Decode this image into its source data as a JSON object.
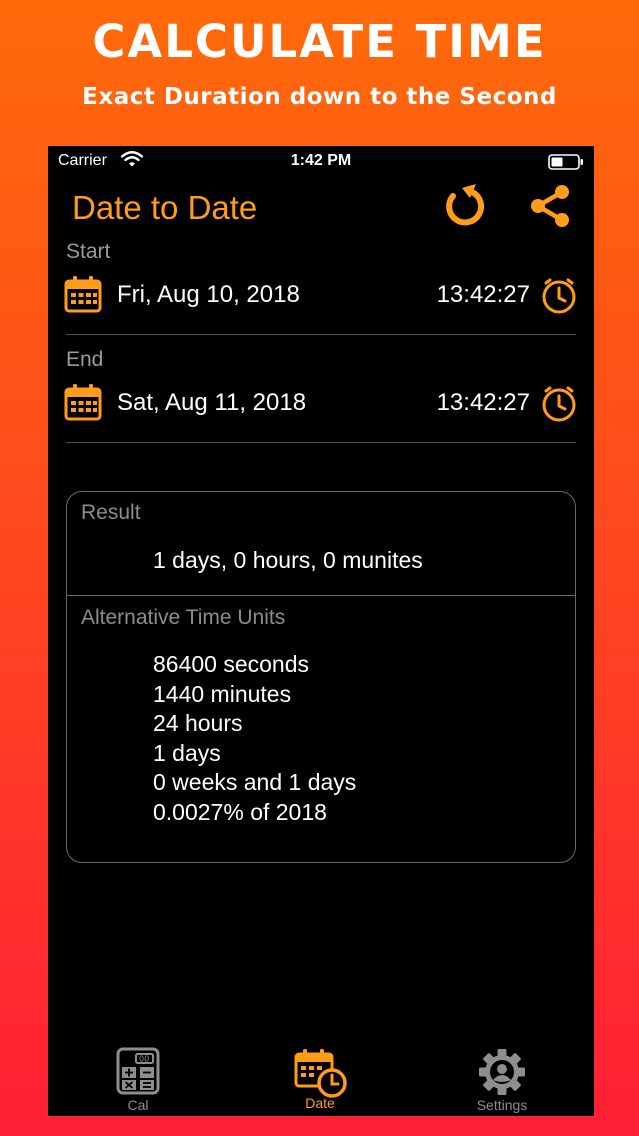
{
  "promo": {
    "title": "CALCULATE TIME",
    "subtitle": "Exact Duration down to the Second"
  },
  "status_bar": {
    "carrier": "Carrier",
    "time": "1:42 PM",
    "icons": [
      "wifi-icon",
      "battery-icon"
    ]
  },
  "nav": {
    "title": "Date to Date",
    "actions": [
      "refresh-icon",
      "share-icon"
    ]
  },
  "start": {
    "label": "Start",
    "date": "Fri, Aug 10, 2018",
    "time": "13:42:27"
  },
  "end": {
    "label": "End",
    "date": "Sat, Aug 11, 2018",
    "time": "13:42:27"
  },
  "result": {
    "label": "Result",
    "value": "1 days, 0 hours, 0 munites"
  },
  "alternative": {
    "label": "Alternative Time Units",
    "items": [
      "86400 seconds",
      "1440 minutes",
      "24 hours",
      "1 days",
      "0 weeks and 1 days",
      "0.0027% of 2018"
    ]
  },
  "tabs": [
    {
      "label": "Cal",
      "icon": "calculator-icon",
      "active": false
    },
    {
      "label": "Date",
      "icon": "calendar-clock-icon",
      "active": true
    },
    {
      "label": "Settings",
      "icon": "gear-icon",
      "active": false
    }
  ],
  "colors": {
    "accent": "#ff9d1a",
    "background": "#000000",
    "inactive_tab": "#8e8e8e",
    "promo_gradient_top": "#ff6a0a",
    "promo_gradient_bottom": "#ff1f35"
  }
}
